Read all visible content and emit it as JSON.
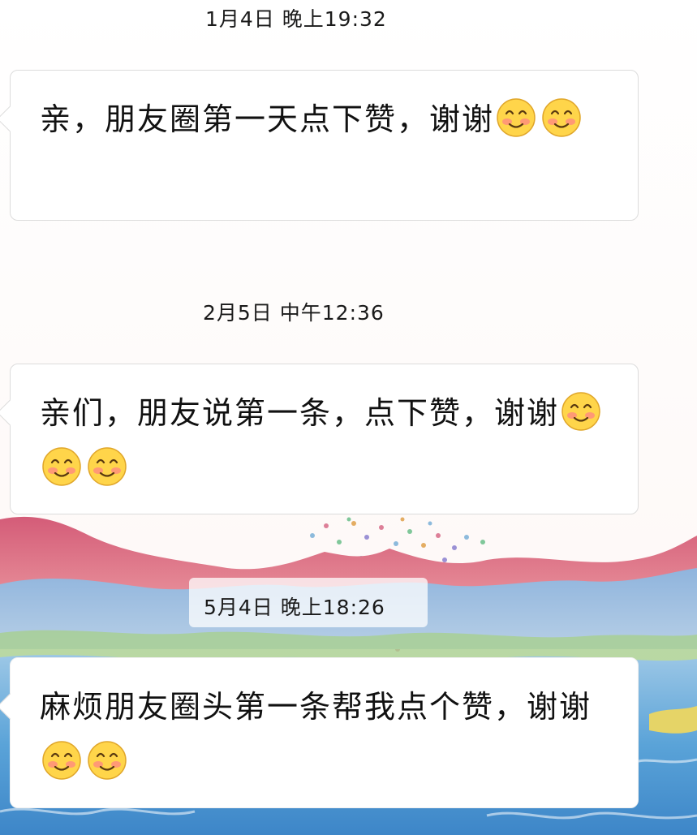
{
  "messages": [
    {
      "timestamp": "1月4日 晚上19:32",
      "text": "亲，朋友圈第一天点下赞，谢谢",
      "emoji_count": 2
    },
    {
      "timestamp": "2月5日 中午12:36",
      "text": "亲们，朋友说第一条，点下赞，谢谢",
      "emoji_count": 3
    },
    {
      "timestamp": "5月4日 晚上18:26",
      "text": "麻烦朋友圈头第一条帮我点个赞，谢谢",
      "emoji_count": 2
    }
  ],
  "emoji": {
    "name": "smiling-face-with-blush-icon",
    "face_color": "#FFD54A",
    "blush_color": "#FF8A80"
  }
}
